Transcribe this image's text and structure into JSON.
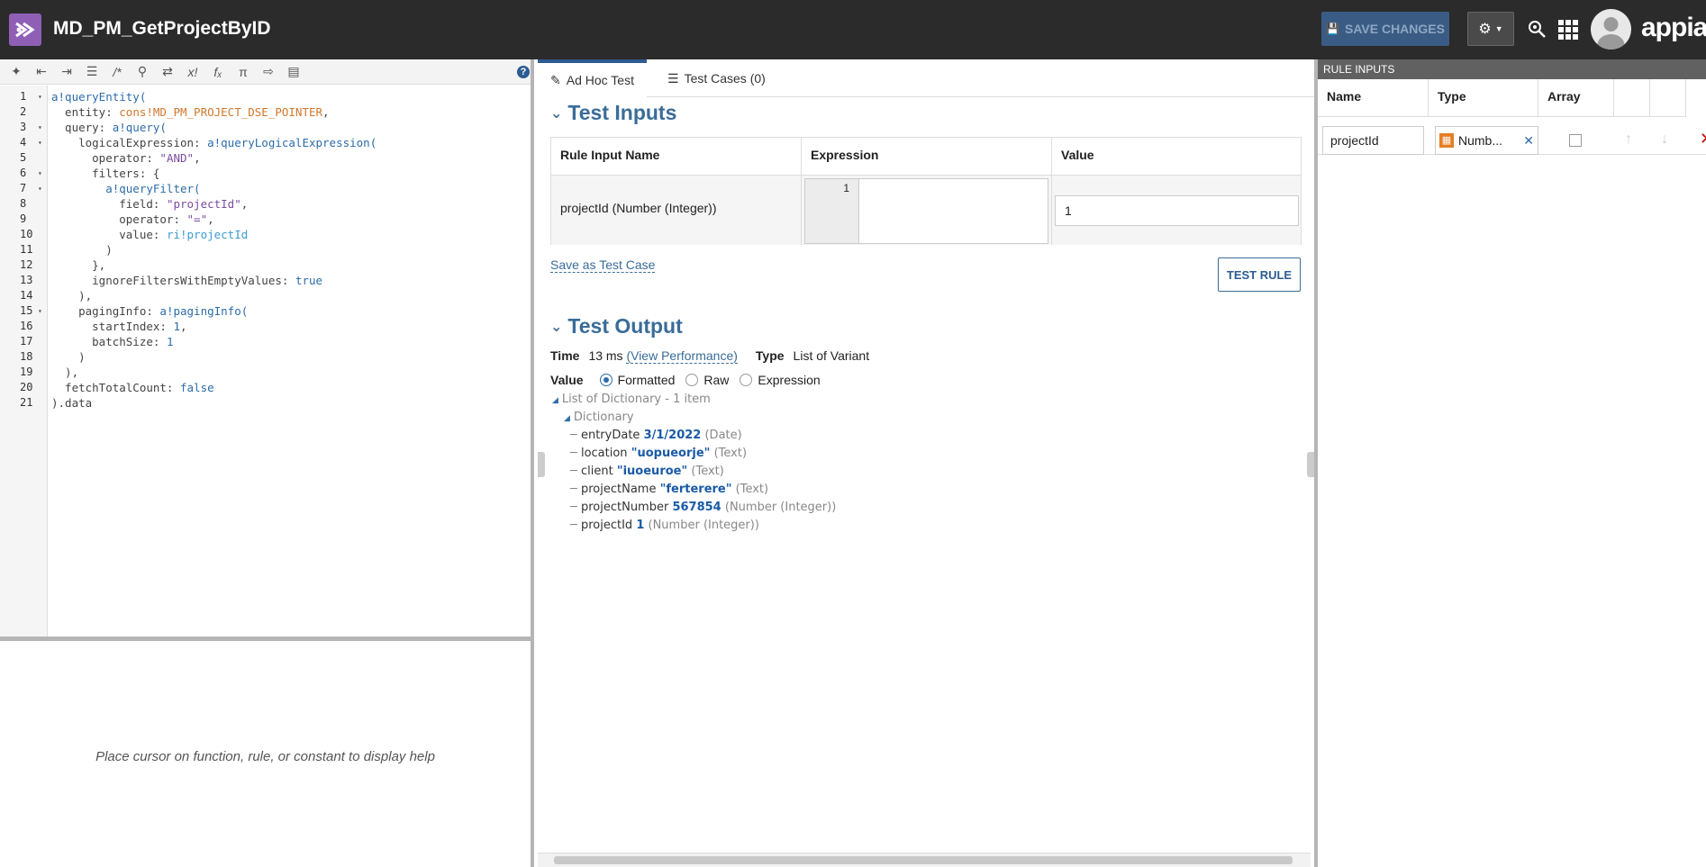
{
  "header": {
    "title": "MD_PM_GetProjectByID",
    "save_label": "SAVE CHANGES",
    "brand": "appian"
  },
  "editor": {
    "lines": [
      {
        "n": "1",
        "fold": true,
        "seg": [
          [
            "kw",
            "a!queryEntity("
          ]
        ]
      },
      {
        "n": "2",
        "fold": false,
        "seg": [
          [
            "pl",
            "  entity: "
          ],
          [
            "co",
            "cons!MD_PM_PROJECT_DSE_POINTER"
          ],
          [
            "pl",
            ","
          ]
        ]
      },
      {
        "n": "3",
        "fold": true,
        "seg": [
          [
            "pl",
            "  query: "
          ],
          [
            "kw",
            "a!query("
          ]
        ]
      },
      {
        "n": "4",
        "fold": true,
        "seg": [
          [
            "pl",
            "    logicalExpression: "
          ],
          [
            "kw",
            "a!queryLogicalExpression("
          ]
        ]
      },
      {
        "n": "5",
        "fold": false,
        "seg": [
          [
            "pl",
            "      operator: "
          ],
          [
            "st",
            "\"AND\""
          ],
          [
            "pl",
            ","
          ]
        ]
      },
      {
        "n": "6",
        "fold": true,
        "seg": [
          [
            "pl",
            "      filters: {"
          ]
        ]
      },
      {
        "n": "7",
        "fold": true,
        "seg": [
          [
            "kw",
            "        a!queryFilter("
          ]
        ]
      },
      {
        "n": "8",
        "fold": false,
        "seg": [
          [
            "pl",
            "          field: "
          ],
          [
            "st",
            "\"projectId\""
          ],
          [
            "pl",
            ","
          ]
        ]
      },
      {
        "n": "9",
        "fold": false,
        "seg": [
          [
            "pl",
            "          operator: "
          ],
          [
            "st",
            "\"=\""
          ],
          [
            "pl",
            ","
          ]
        ]
      },
      {
        "n": "10",
        "fold": false,
        "seg": [
          [
            "pl",
            "          value: "
          ],
          [
            "ri",
            "ri!projectId"
          ]
        ]
      },
      {
        "n": "11",
        "fold": false,
        "seg": [
          [
            "pl",
            "        )"
          ]
        ]
      },
      {
        "n": "12",
        "fold": false,
        "seg": [
          [
            "pl",
            "      },"
          ]
        ]
      },
      {
        "n": "13",
        "fold": false,
        "seg": [
          [
            "pl",
            "      ignoreFiltersWithEmptyValues: "
          ],
          [
            "nm",
            "true"
          ]
        ]
      },
      {
        "n": "14",
        "fold": false,
        "seg": [
          [
            "pl",
            "    ),"
          ]
        ]
      },
      {
        "n": "15",
        "fold": true,
        "seg": [
          [
            "pl",
            "    pagingInfo: "
          ],
          [
            "kw",
            "a!pagingInfo("
          ]
        ]
      },
      {
        "n": "16",
        "fold": false,
        "seg": [
          [
            "pl",
            "      startIndex: "
          ],
          [
            "nm",
            "1"
          ],
          [
            "pl",
            ","
          ]
        ]
      },
      {
        "n": "17",
        "fold": false,
        "seg": [
          [
            "pl",
            "      batchSize: "
          ],
          [
            "nm",
            "1"
          ]
        ]
      },
      {
        "n": "18",
        "fold": false,
        "seg": [
          [
            "pl",
            "    )"
          ]
        ]
      },
      {
        "n": "19",
        "fold": false,
        "seg": [
          [
            "pl",
            "  ),"
          ]
        ]
      },
      {
        "n": "20",
        "fold": false,
        "seg": [
          [
            "pl",
            "  fetchTotalCount: "
          ],
          [
            "nm",
            "false"
          ]
        ]
      },
      {
        "n": "21",
        "fold": false,
        "seg": [
          [
            "pl",
            ").data"
          ]
        ]
      }
    ],
    "help_text": "Place cursor on function, rule, or constant to display help"
  },
  "tabs": {
    "adhoc": "Ad Hoc Test",
    "cases": "Test Cases (0)"
  },
  "test_inputs": {
    "heading": "Test Inputs",
    "col_name": "Rule Input Name",
    "col_expr": "Expression",
    "col_value": "Value",
    "row_name": "projectId (Number (Integer))",
    "expr_line": "1",
    "row_value": "1",
    "save_case": "Save as Test Case",
    "test_rule": "TEST RULE"
  },
  "test_output": {
    "heading": "Test Output",
    "time_label": "Time",
    "time_value": "13 ms",
    "view_perf": "(View Performance)",
    "type_label": "Type",
    "type_value": "List of Variant",
    "value_label": "Value",
    "opt_formatted": "Formatted",
    "opt_raw": "Raw",
    "opt_expression": "Expression",
    "tree_root": "List of Dictionary - 1 item",
    "tree_dict": "Dictionary",
    "fields": [
      {
        "key": "entryDate",
        "val": "3/1/2022",
        "type": "(Date)"
      },
      {
        "key": "location",
        "val": "\"uopueorje\"",
        "type": "(Text)"
      },
      {
        "key": "client",
        "val": "\"iuoeuroe\"",
        "type": "(Text)"
      },
      {
        "key": "projectName",
        "val": "\"ferterere\"",
        "type": "(Text)"
      },
      {
        "key": "projectNumber",
        "val": "567854",
        "type": "(Number (Integer))"
      },
      {
        "key": "projectId",
        "val": "1",
        "type": "(Number (Integer))"
      }
    ]
  },
  "rule_inputs": {
    "header": "RULE INPUTS",
    "col_name": "Name",
    "col_type": "Type",
    "col_array": "Array",
    "name_value": "projectId",
    "type_value": "Numb..."
  }
}
